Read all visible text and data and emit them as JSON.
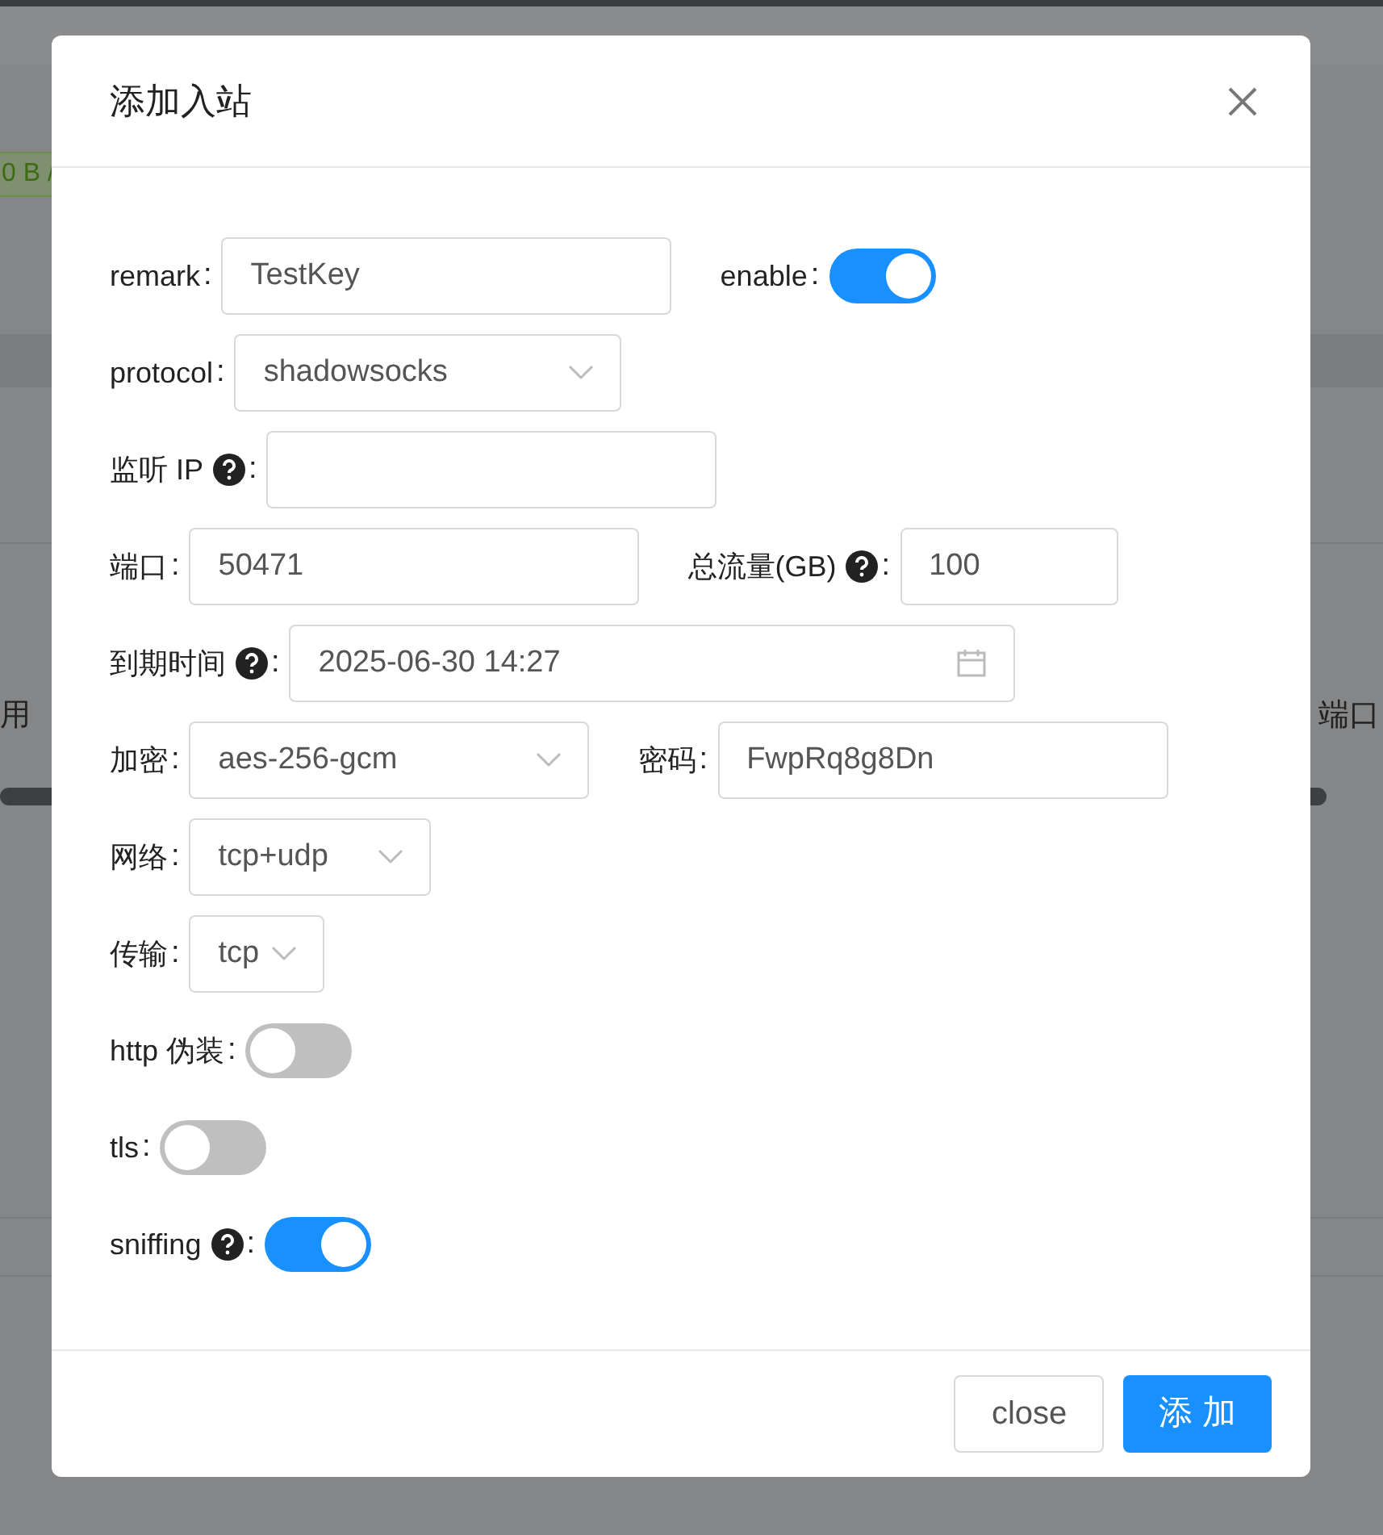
{
  "background": {
    "tag": "0 B /",
    "column_left": "用",
    "column_right": "端口"
  },
  "dialog": {
    "title": "添加入站",
    "rows": [
      {
        "items": [
          {
            "kind": "input",
            "label": "remark",
            "colon": ":",
            "value": "TestKey"
          },
          {
            "kind": "switch",
            "label": "enable",
            "colon": ":",
            "on": true
          }
        ]
      },
      {
        "items": [
          {
            "kind": "select",
            "label": "protocol",
            "colon": ":",
            "value": "shadowsocks"
          }
        ]
      },
      {
        "items": [
          {
            "kind": "input",
            "label": "监听 IP",
            "help": true,
            "colon": ":"
          }
        ]
      },
      {
        "items": [
          {
            "kind": "input",
            "label": "端口",
            "colon": ":",
            "value": "50471"
          },
          {
            "kind": "input",
            "label": "总流量(GB)",
            "help": true,
            "colon": ":",
            "value": "100"
          }
        ]
      },
      {
        "items": [
          {
            "kind": "date",
            "label": "到期时间",
            "help": true,
            "colon": ":",
            "value": "2025-06-30 14:27"
          }
        ]
      },
      {
        "items": [
          {
            "kind": "select",
            "label": "加密",
            "colon": ":",
            "value": "aes-256-gcm"
          },
          {
            "kind": "input",
            "label": "密码",
            "colon": ":",
            "value": "FwpRq8g8Dn"
          }
        ]
      },
      {
        "items": [
          {
            "kind": "select",
            "label": "网络",
            "colon": ":",
            "value": "tcp+udp"
          }
        ]
      },
      {
        "items": [
          {
            "kind": "select",
            "label": "传输",
            "colon": ":",
            "value": "tcp"
          }
        ]
      },
      {
        "items": [
          {
            "kind": "switch",
            "label": "http 伪装",
            "colon": ":",
            "on": false
          }
        ]
      },
      {
        "items": [
          {
            "kind": "switch",
            "label": "tls",
            "colon": ":",
            "on": false
          }
        ]
      },
      {
        "items": [
          {
            "kind": "switch",
            "label": "sniffing",
            "help": true,
            "colon": ":",
            "on": true
          }
        ]
      }
    ],
    "buttons": [
      {
        "label": "close",
        "kind": "default"
      },
      {
        "label": "添 加",
        "kind": "primary"
      }
    ]
  }
}
